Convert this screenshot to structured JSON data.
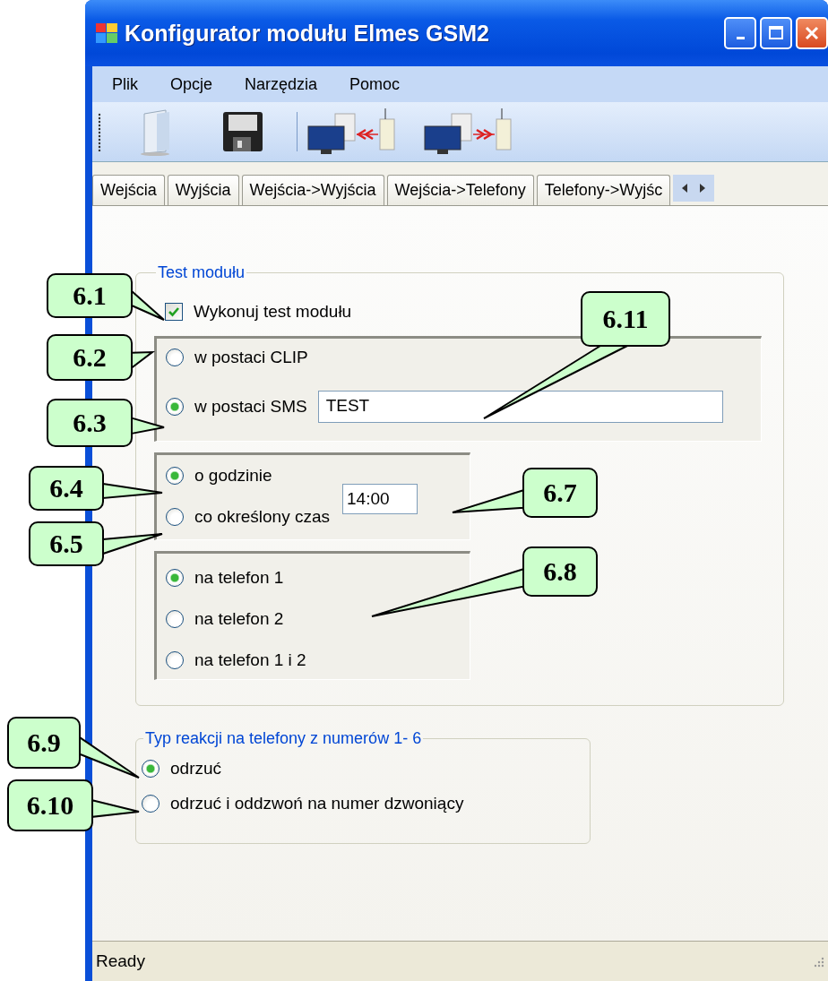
{
  "window": {
    "title": "Konfigurator modułu Elmes GSM2"
  },
  "menu": [
    {
      "label": "Plik"
    },
    {
      "label": "Opcje"
    },
    {
      "label": "Narzędzia"
    },
    {
      "label": "Pomoc"
    }
  ],
  "tabs": [
    {
      "label": "Wejścia",
      "selected": false
    },
    {
      "label": "Wyjścia",
      "selected": false
    },
    {
      "label": "Wejścia->Wyjścia",
      "selected": false
    },
    {
      "label": "Wejścia->Telefony",
      "selected": false
    },
    {
      "label": "Telefony->Wyjśc",
      "selected": false
    }
  ],
  "test_group": {
    "title": "Test modułu",
    "checkbox": {
      "label": "Wykonuj test modułu",
      "checked": true
    },
    "format_options": [
      {
        "label": "w postaci CLIP",
        "selected": false
      },
      {
        "label": "w postaci SMS",
        "selected": true
      }
    ],
    "sms_text": {
      "value": "TEST"
    },
    "schedule_options": [
      {
        "label": "o godzinie",
        "selected": true
      },
      {
        "label": "co określony czas",
        "selected": false
      }
    ],
    "time": {
      "value": "14:00"
    },
    "phone_options": [
      {
        "label": "na telefon 1",
        "selected": true
      },
      {
        "label": "na telefon 2",
        "selected": false
      },
      {
        "label": "na telefon 1 i 2",
        "selected": false
      }
    ]
  },
  "reaction_group": {
    "title": "Typ reakcji na telefony z numerów 1- 6",
    "options": [
      {
        "label": "odrzuć",
        "selected": true
      },
      {
        "label": "odrzuć i oddzwoń na numer dzwoniący",
        "selected": false
      }
    ]
  },
  "status_bar": {
    "text": "Ready"
  },
  "callouts": [
    {
      "label": "6.1"
    },
    {
      "label": "6.2"
    },
    {
      "label": "6.3"
    },
    {
      "label": "6.11"
    },
    {
      "label": "6.4"
    },
    {
      "label": "6.5"
    },
    {
      "label": "6.7"
    },
    {
      "label": "6.8"
    },
    {
      "label": "6.9"
    },
    {
      "label": "6.10"
    }
  ]
}
